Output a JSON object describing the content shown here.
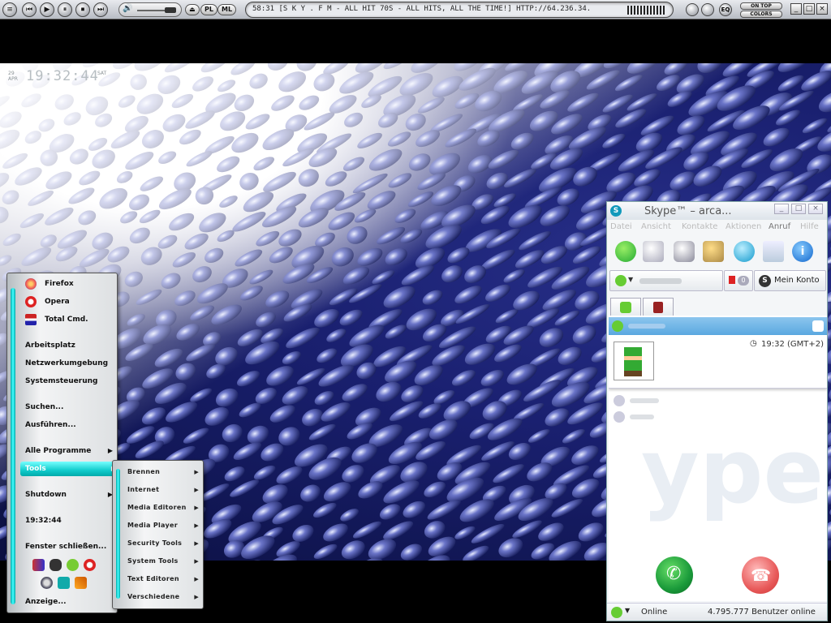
{
  "winamp": {
    "buttons": [
      "⏮",
      "▶",
      "⏸",
      "⏹",
      "⏭"
    ],
    "pills": [
      "PL",
      "ML"
    ],
    "now_playing": "58:31  [S K Y . F M - ALL HIT 70S - ALL HITS, ALL THE TIME!] HTTP://64.236.34.",
    "on_top": "ON TOP",
    "colors": "COLORS",
    "eq": "EQ"
  },
  "clock": {
    "date": "29 APR",
    "time": "19:32:44",
    "day": "SAT"
  },
  "start_menu": {
    "pinned": [
      "Firefox",
      "Opera",
      "Total Cmd."
    ],
    "places": [
      "Arbeitsplatz",
      "Netzwerkumgebung",
      "Systemsteuerung"
    ],
    "actions": [
      "Suchen...",
      "Ausführen..."
    ],
    "programs": "Alle Programme",
    "tools": "Tools",
    "shutdown": "Shutdown",
    "clock": "19:32:44",
    "close_windows": "Fenster schließen...",
    "display": "Anzeige..."
  },
  "submenu": {
    "items": [
      "Brennen",
      "Internet",
      "Media Editoren",
      "Media Player",
      "Security Tools",
      "System Tools",
      "Text Editoren",
      "Verschiedene"
    ]
  },
  "skype": {
    "title": "Skype™ – arca...",
    "menu": [
      "Datei",
      "Ansicht",
      "Kontakte",
      "Aktionen",
      "Anruf",
      "Hilfe"
    ],
    "flag_count": "0",
    "my_account": "Mein Konto",
    "contact_time": "19:32 (GMT+2)",
    "status": "Online",
    "users_online": "4.795.777 Benutzer online"
  },
  "colors": {
    "accent_cyan": "#17c9c9",
    "skype_blue": "#5aa8e0",
    "call_green": "#1a9a3a",
    "hangup_red": "#e85a5a"
  }
}
